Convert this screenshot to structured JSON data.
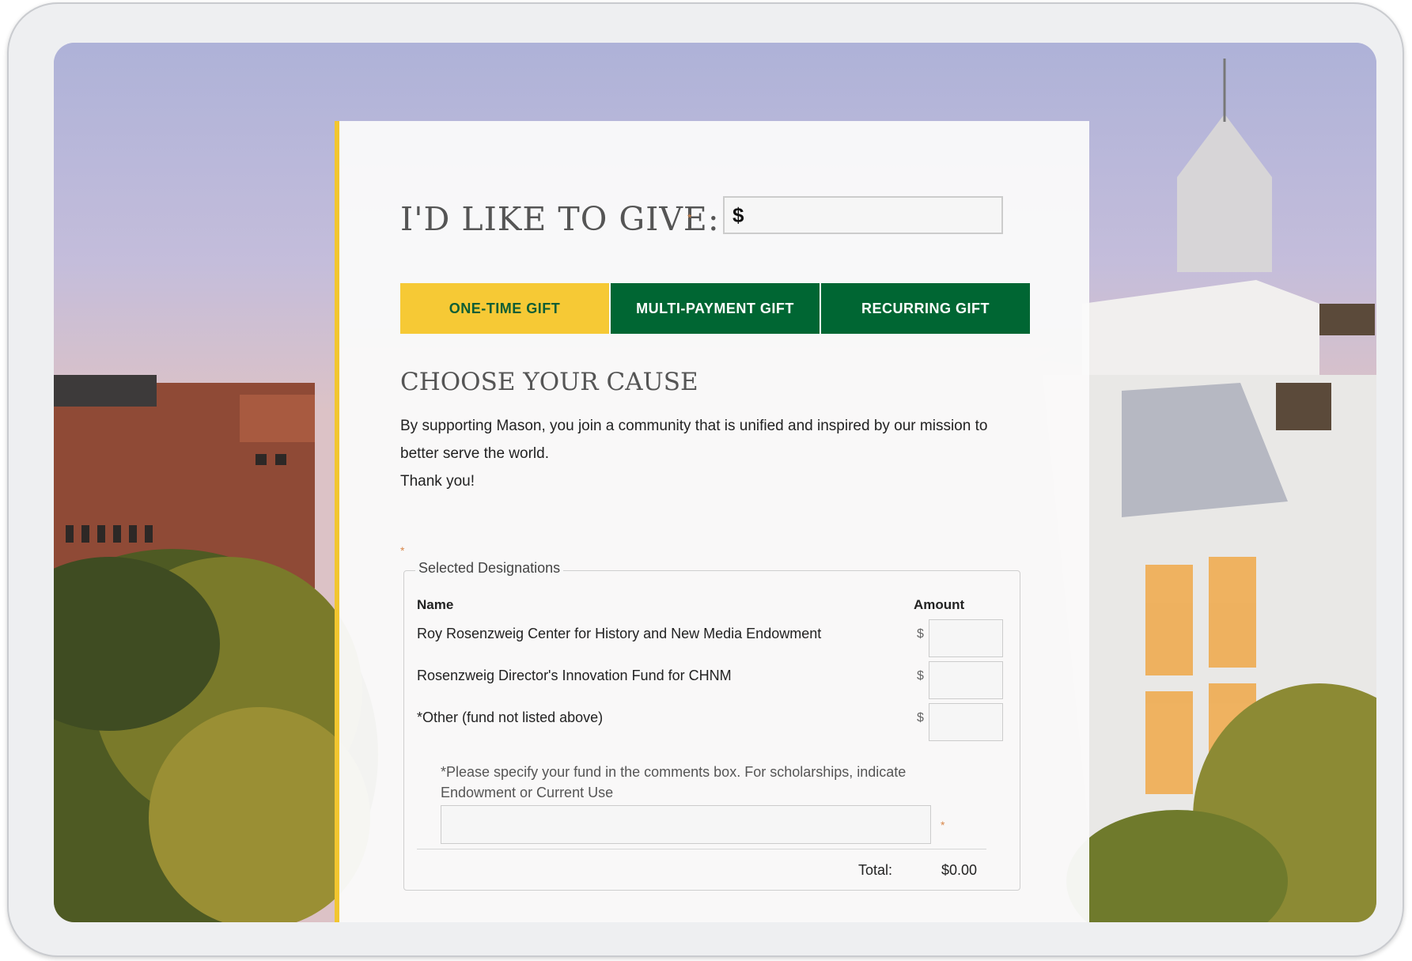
{
  "form": {
    "give_label": "I'D LIKE TO GIVE:",
    "required_mark": "*",
    "amount_prefix": "$",
    "tabs": [
      {
        "label": "ONE-TIME GIFT",
        "active": true
      },
      {
        "label": "MULTI-PAYMENT GIFT",
        "active": false
      },
      {
        "label": "RECURRING GIFT",
        "active": false
      }
    ],
    "cause_title": "CHOOSE YOUR CAUSE",
    "cause_text_1": "By supporting Mason, you join a community that is unified and inspired by our mission to better serve the world.",
    "cause_text_2": "Thank you!",
    "designations": {
      "legend": "Selected Designations",
      "col_name": "Name",
      "col_amount": "Amount",
      "currency": "$",
      "rows": [
        {
          "name": "Roy Rosenzweig Center for History and New Media Endowment"
        },
        {
          "name": "Rosenzweig Director's Innovation Fund for CHNM"
        },
        {
          "name": "*Other (fund not listed above)"
        }
      ],
      "note": "*Please specify your fund in the comments box. For scholarships, indicate Endowment or Current Use",
      "total_label": "Total:",
      "total_value": "$0.00"
    }
  },
  "colors": {
    "accent_yellow": "#f6c935",
    "mason_green": "#006633",
    "panel_border": "#f2c62f"
  }
}
